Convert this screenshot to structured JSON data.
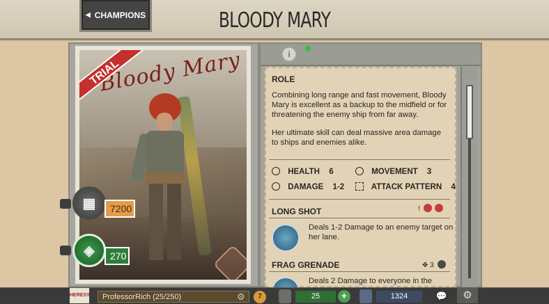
{
  "header": {
    "title": "BLOODY MARY",
    "back_button_label": "CHAMPIONS"
  },
  "card": {
    "badge": "TRIAL",
    "name_script": "Bloody Mary",
    "gold_price": "7200",
    "green_price": "270"
  },
  "info": {
    "info_symbol": "i",
    "role_title": "ROLE",
    "role_paragraph_1": "Combining long range and fast movement, Bloody Mary is excellent as a backup to the midfield or for threatening the enemy ship from far away.",
    "role_paragraph_2": "Her ultimate skill can deal massive area damage to ships and enemies alike.",
    "stats": {
      "health_label": "HEALTH",
      "health_value": "6",
      "movement_label": "MOVEMENT",
      "movement_value": "3",
      "damage_label": "DAMAGE",
      "damage_value": "1-2",
      "attack_pattern_label": "ATTACK PATTERN",
      "attack_pattern_value": "4"
    },
    "abilities": [
      {
        "name": "LONG SHOT",
        "tag": "!",
        "description": "Deals 1-2 Damage to an enemy target on her lane."
      },
      {
        "name": "FRAG GRENADE",
        "tag": "3",
        "description": "Deals 2 Damage to everyone in the"
      }
    ]
  },
  "bottom_bar": {
    "logo_text": "HERESY",
    "username": "ProfessorRich (25/250)",
    "gear_symbol": "⚙",
    "level": "7",
    "green_currency": "25",
    "plus_symbol": "+",
    "cash": "1324",
    "settings_symbol": "⚙"
  }
}
